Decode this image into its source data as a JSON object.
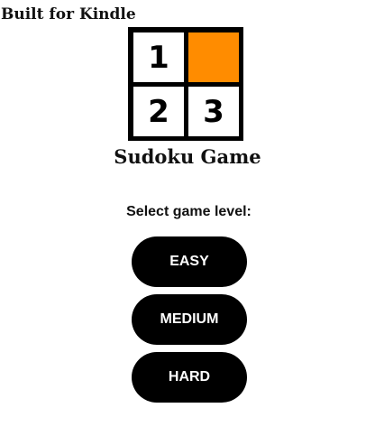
{
  "header": {
    "brand_text": "Built for Kindle"
  },
  "logo": {
    "cells": [
      "1",
      "",
      "2",
      "3"
    ],
    "accent_color": "#FF8C00"
  },
  "title": "Sudoku Game",
  "level_select": {
    "prompt": "Select game level:",
    "levels": [
      "EASY",
      "MEDIUM",
      "HARD"
    ]
  }
}
